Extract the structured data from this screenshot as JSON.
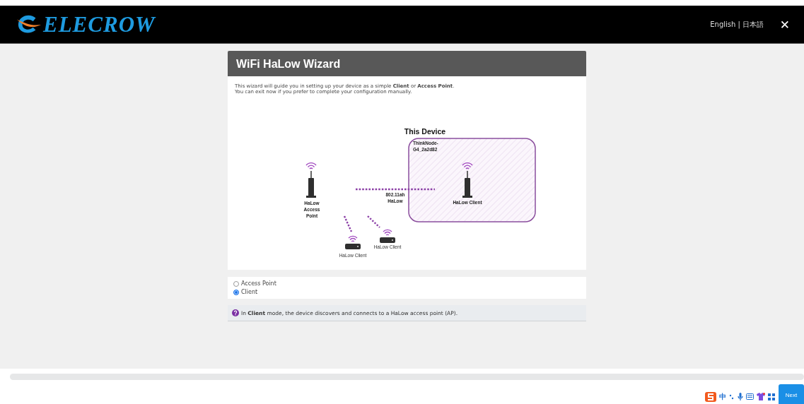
{
  "header": {
    "logo": "ELECROW",
    "languages": [
      "English",
      "日本語"
    ],
    "separator": "|",
    "close": "✕"
  },
  "wizard": {
    "title": "WiFi HaLow Wizard",
    "intro": [
      "This wizard will guide you in setting up your device as a simple **Client** or **Access Point**.",
      "You can exit now if you prefer to complete your configuration manually."
    ],
    "diagram": {
      "this_device": "This Device",
      "device_name": [
        "ThinkNode-",
        "G4_2a2d82"
      ],
      "link_label": [
        "802.11ah",
        "HaLow"
      ],
      "access_point_label": [
        "HaLow",
        "Access",
        "Point"
      ],
      "this_client_label": "HaLow Client",
      "other_clients": [
        "HaLow Client",
        "HaLow Client"
      ]
    },
    "modes": [
      {
        "label": "Access Point",
        "selected": false
      },
      {
        "label": "Client",
        "selected": true
      }
    ],
    "info": "In **Client** mode, the device discovers and connects to a HaLow access point (AP)."
  },
  "footer": {
    "next": "Next"
  },
  "ime_toolbar": {
    "language": "中"
  }
}
